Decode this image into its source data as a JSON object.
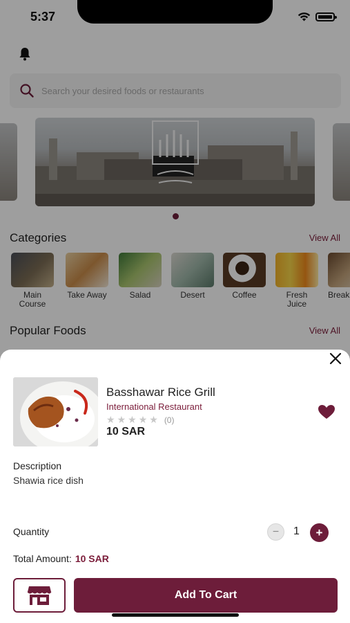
{
  "status_bar": {
    "time": "5:37"
  },
  "search": {
    "placeholder": "Search your desired foods or restaurants"
  },
  "sections": {
    "categories_title": "Categories",
    "popular_title": "Popular Foods",
    "view_all": "View All"
  },
  "categories": [
    {
      "label": "Main Course",
      "icon": "main-course-photo"
    },
    {
      "label": "Take Away",
      "icon": "take-away-photo"
    },
    {
      "label": "Salad",
      "icon": "salad-photo"
    },
    {
      "label": "Desert",
      "icon": "desert-photo"
    },
    {
      "label": "Coffee",
      "icon": "coffee-photo"
    },
    {
      "label": "Fresh Juice",
      "icon": "fresh-juice-photo"
    },
    {
      "label": "Break",
      "icon": "break-photo"
    }
  ],
  "product": {
    "name": "Basshawar Rice Grill",
    "restaurant": "International Restaurant",
    "rating_count": "(0)",
    "rating": 0,
    "max_rating": 5,
    "price": "10 SAR",
    "description_label": "Description",
    "description": "Shawia rice dish",
    "quantity_label": "Quantity",
    "quantity": "1",
    "total_label": "Total Amount:",
    "total_value": "10 SAR",
    "add_to_cart_label": "Add To Cart",
    "favorited": true
  },
  "colors": {
    "accent": "#6d1d3a",
    "accent_text": "#7b1d3a",
    "overlay": "rgba(0,0,0,0.38)"
  }
}
